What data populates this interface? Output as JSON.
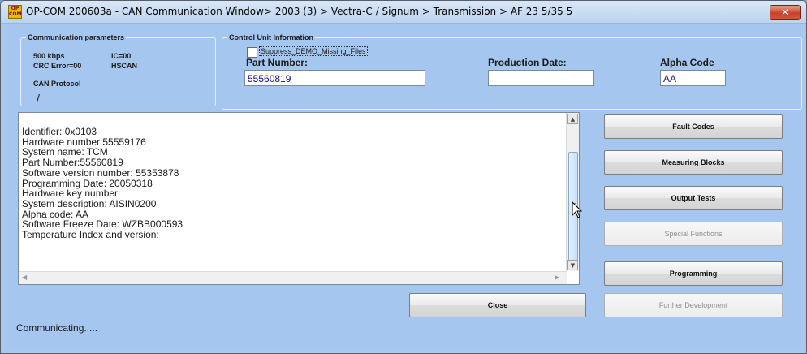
{
  "window": {
    "title": "OP-COM 200603a - CAN Communication Window> 2003 (3) > Vectra-C / Signum > Transmission > AF 23 5/35 5",
    "app_icon_text": "OP\nCOM",
    "close_glyph": "✕"
  },
  "comm_params": {
    "legend": "Communication parameters",
    "baud": "500 kbps",
    "ic": "IC=00",
    "crc": "CRC Error=00",
    "bus": "HSCAN",
    "protocol_label": "CAN Protocol",
    "activity": "/"
  },
  "control_unit": {
    "legend": "Control Unit Information",
    "suppress_label": "Suppress_DEMO_Missing_Files",
    "suppress_checked": false,
    "part_number_label": "Part Number:",
    "part_number_value": "55560819",
    "production_date_label": "Production Date:",
    "production_date_value": "",
    "alpha_code_label": "Alpha Code",
    "alpha_code_value": "AA"
  },
  "info_lines": [
    "Identifier: 0x0103",
    "Hardware number:55559176",
    "System name: TCM",
    "Part Number:55560819",
    "Software version number: 55353878",
    "Programming Date: 20050318",
    "Hardware key number:",
    "System description: AISIN0200",
    "Alpha code: AA",
    "Software Freeze Date: WZBB000593",
    "Temperature Index and version:"
  ],
  "buttons": {
    "fault_codes": "Fault Codes",
    "measuring_blocks": "Measuring Blocks",
    "output_tests": "Output Tests",
    "special_functions": "Special Functions",
    "programming": "Programming",
    "further_development": "Further Development",
    "close": "Close"
  },
  "status": "Communicating....."
}
